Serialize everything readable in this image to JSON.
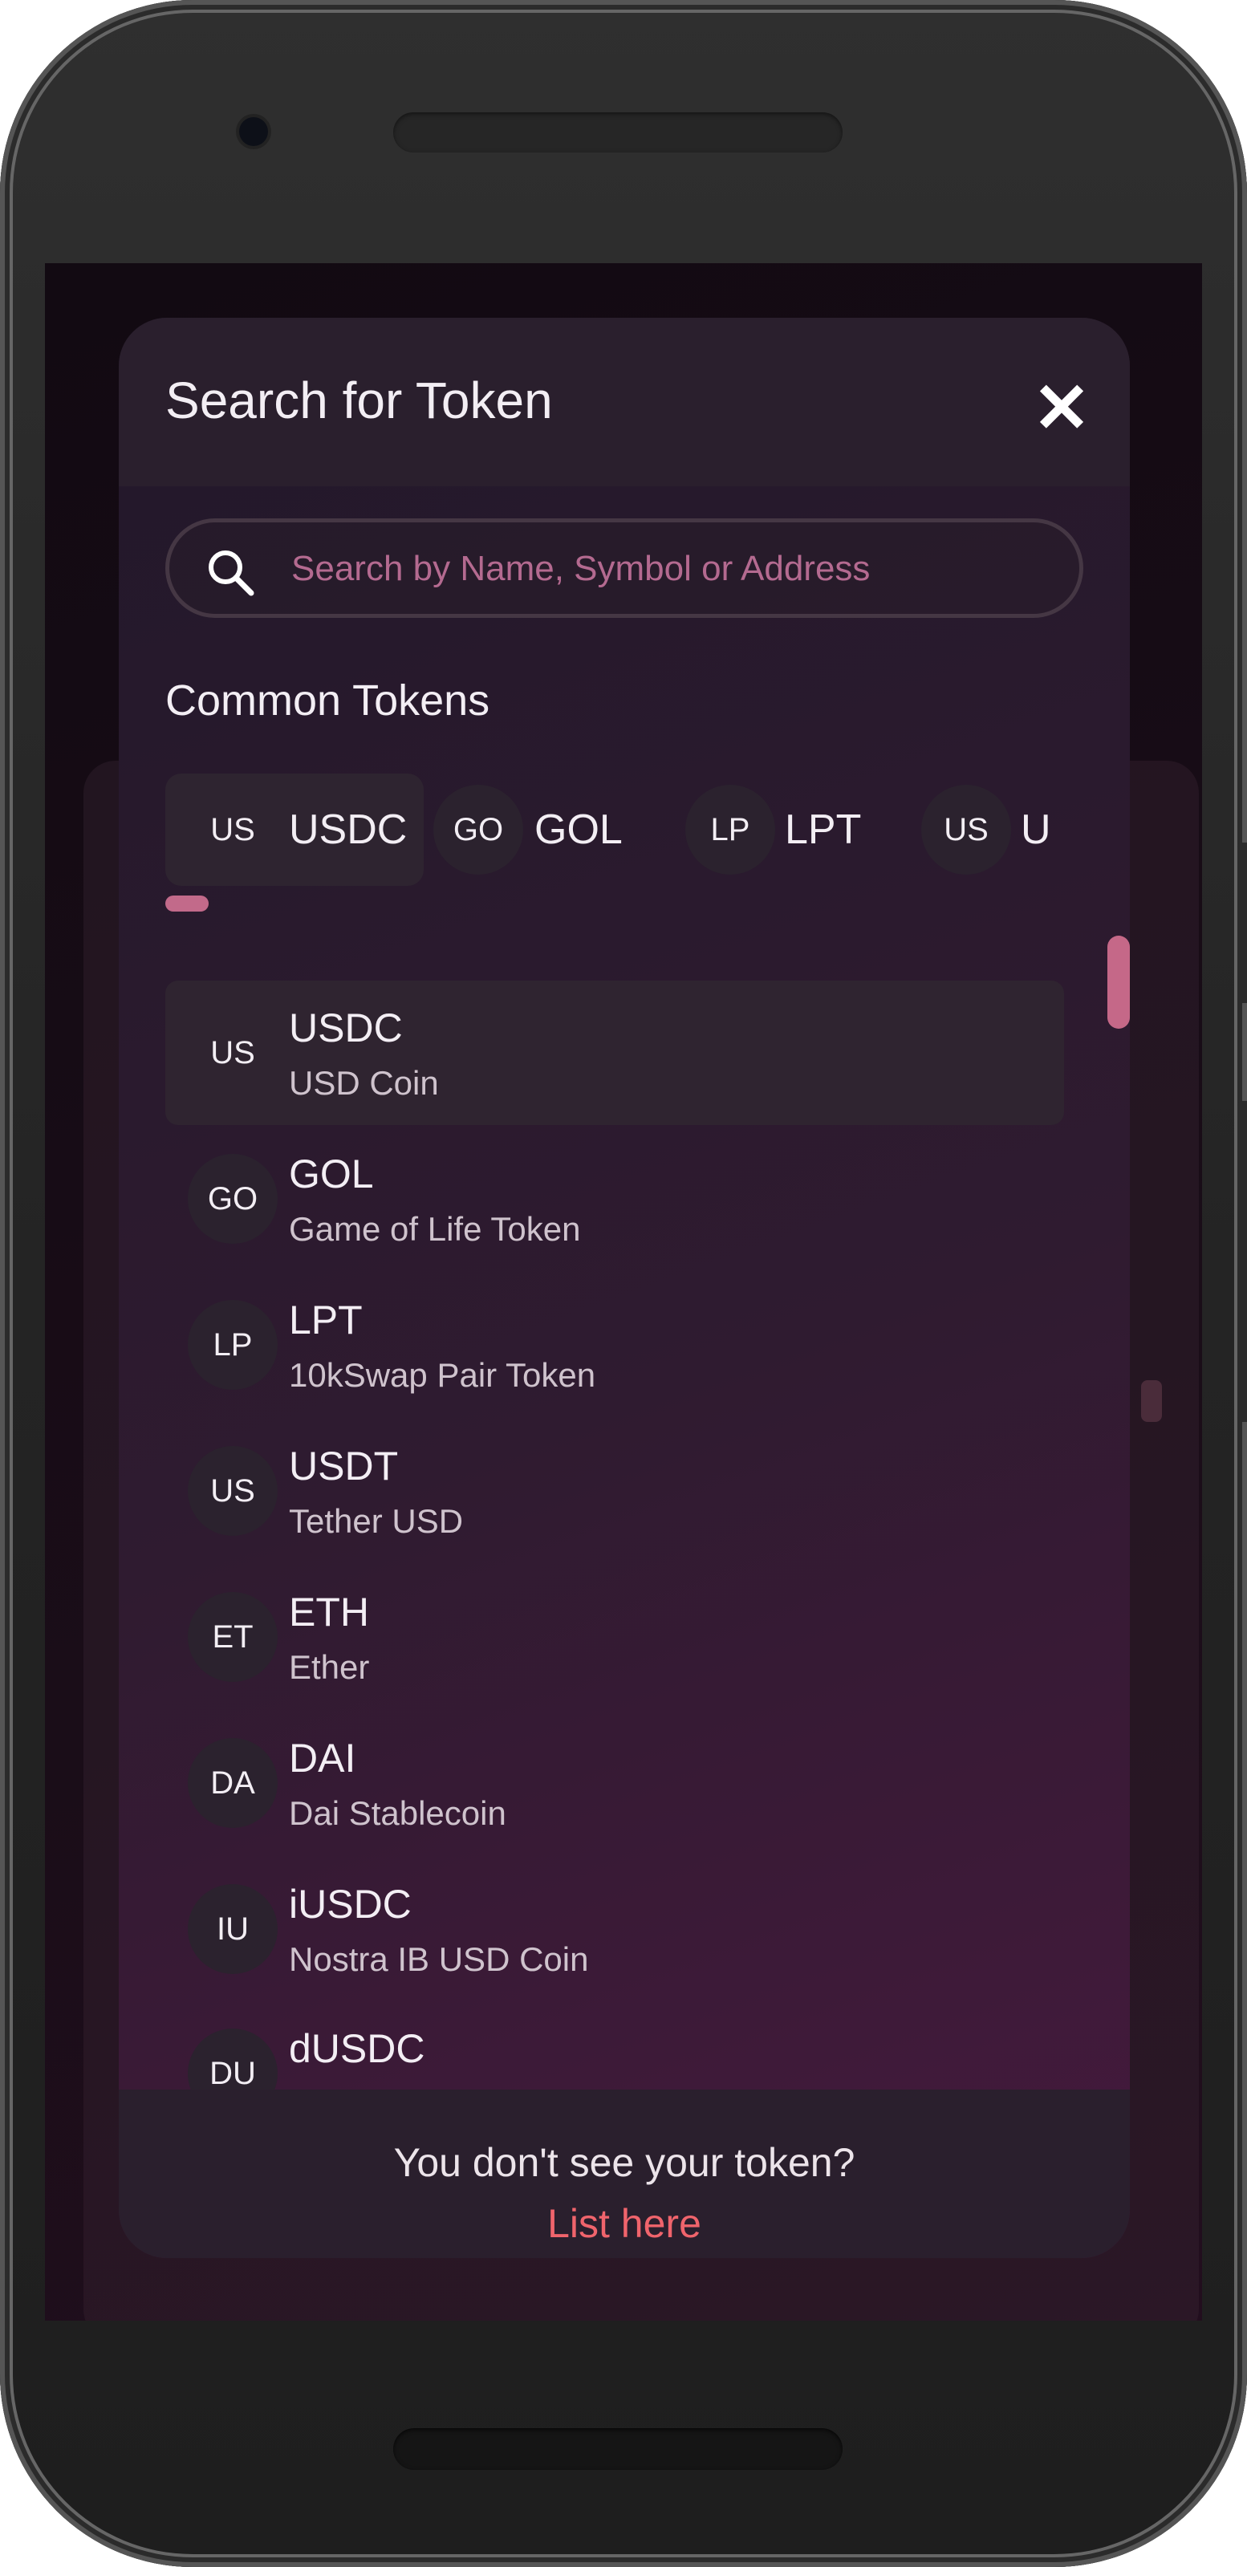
{
  "modal": {
    "title": "Search for Token",
    "close_glyph": "✕"
  },
  "search": {
    "placeholder": "Search by Name, Symbol or Address",
    "value": ""
  },
  "common_tokens": {
    "title": "Common Tokens",
    "items": [
      {
        "avatar": "US",
        "symbol": "USDC"
      },
      {
        "avatar": "GO",
        "symbol": "GOL"
      },
      {
        "avatar": "LP",
        "symbol": "LPT"
      },
      {
        "avatar": "US",
        "symbol": "U"
      }
    ]
  },
  "tokens": [
    {
      "avatar": "US",
      "symbol": "USDC",
      "name": "USD Coin"
    },
    {
      "avatar": "GO",
      "symbol": "GOL",
      "name": "Game of Life Token"
    },
    {
      "avatar": "LP",
      "symbol": "LPT",
      "name": "10kSwap Pair Token"
    },
    {
      "avatar": "US",
      "symbol": "USDT",
      "name": "Tether USD"
    },
    {
      "avatar": "ET",
      "symbol": "ETH",
      "name": "Ether"
    },
    {
      "avatar": "DA",
      "symbol": "DAI",
      "name": "Dai Stablecoin"
    },
    {
      "avatar": "IU",
      "symbol": "iUSDC",
      "name": "Nostra IB USD Coin"
    },
    {
      "avatar": "DU",
      "symbol": "dUSDC",
      "name": ""
    }
  ],
  "footer": {
    "text": "You don't see your token?",
    "link": "List here"
  },
  "colors": {
    "accent": "#f0646c",
    "scroll_thumb": "#c56888",
    "placeholder": "#b46a90"
  },
  "icons": {
    "search": "search-icon",
    "close": "close-icon"
  }
}
